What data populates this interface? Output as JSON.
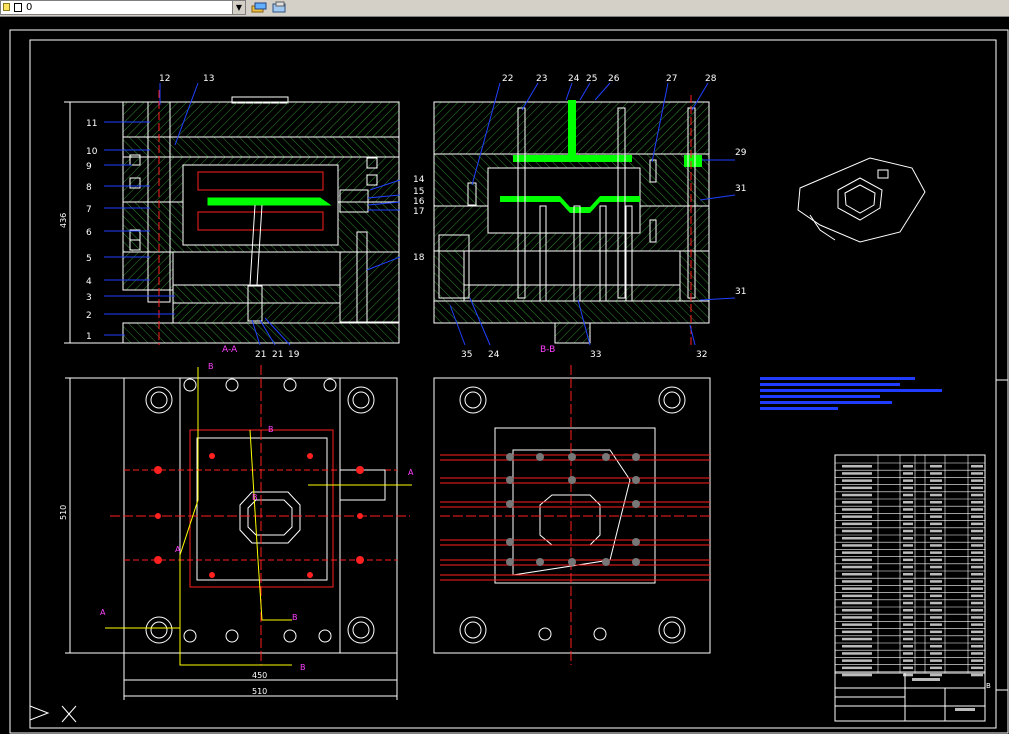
{
  "toolbar": {
    "layer_name": "0",
    "layer_dropdown_icon": "chevron-down-icon",
    "layer_tools": [
      "layer-states-icon",
      "layer-previous-icon"
    ]
  },
  "drawing": {
    "colors": {
      "background": "#000000",
      "frame": "#ffffff",
      "outline": "#ffffff",
      "hatch": "#2e8b2e",
      "cavity": "#00ff00",
      "centerline": "#ff2020",
      "leader": "#2040ff",
      "section": "#ff40ff",
      "hidden": "#ffff00",
      "note": "#1f3cff"
    },
    "callouts_left": [
      "11",
      "10",
      "9",
      "8",
      "7",
      "6",
      "5",
      "4",
      "3",
      "2",
      "1"
    ],
    "callouts_left_top": [
      "12",
      "13"
    ],
    "callouts_left_right": [
      "14",
      "15",
      "16",
      "17",
      "18"
    ],
    "callouts_left_bottom": [
      "21",
      "21",
      "19"
    ],
    "callouts_right_top": [
      "22",
      "23",
      "24",
      "25",
      "26",
      "27",
      "28"
    ],
    "callouts_right_side": [
      "29",
      "31",
      "31"
    ],
    "callouts_right_bottom": [
      "35",
      "24",
      "33",
      "32"
    ],
    "section_labels": {
      "aa": "A-A",
      "bb": "B-B",
      "a": "A",
      "b": "B"
    },
    "dimensions": {
      "left_height": "436",
      "plan_height": "510",
      "plan_width_inner": "450",
      "plan_width_outer": "510"
    },
    "title_block_mark": "B"
  }
}
